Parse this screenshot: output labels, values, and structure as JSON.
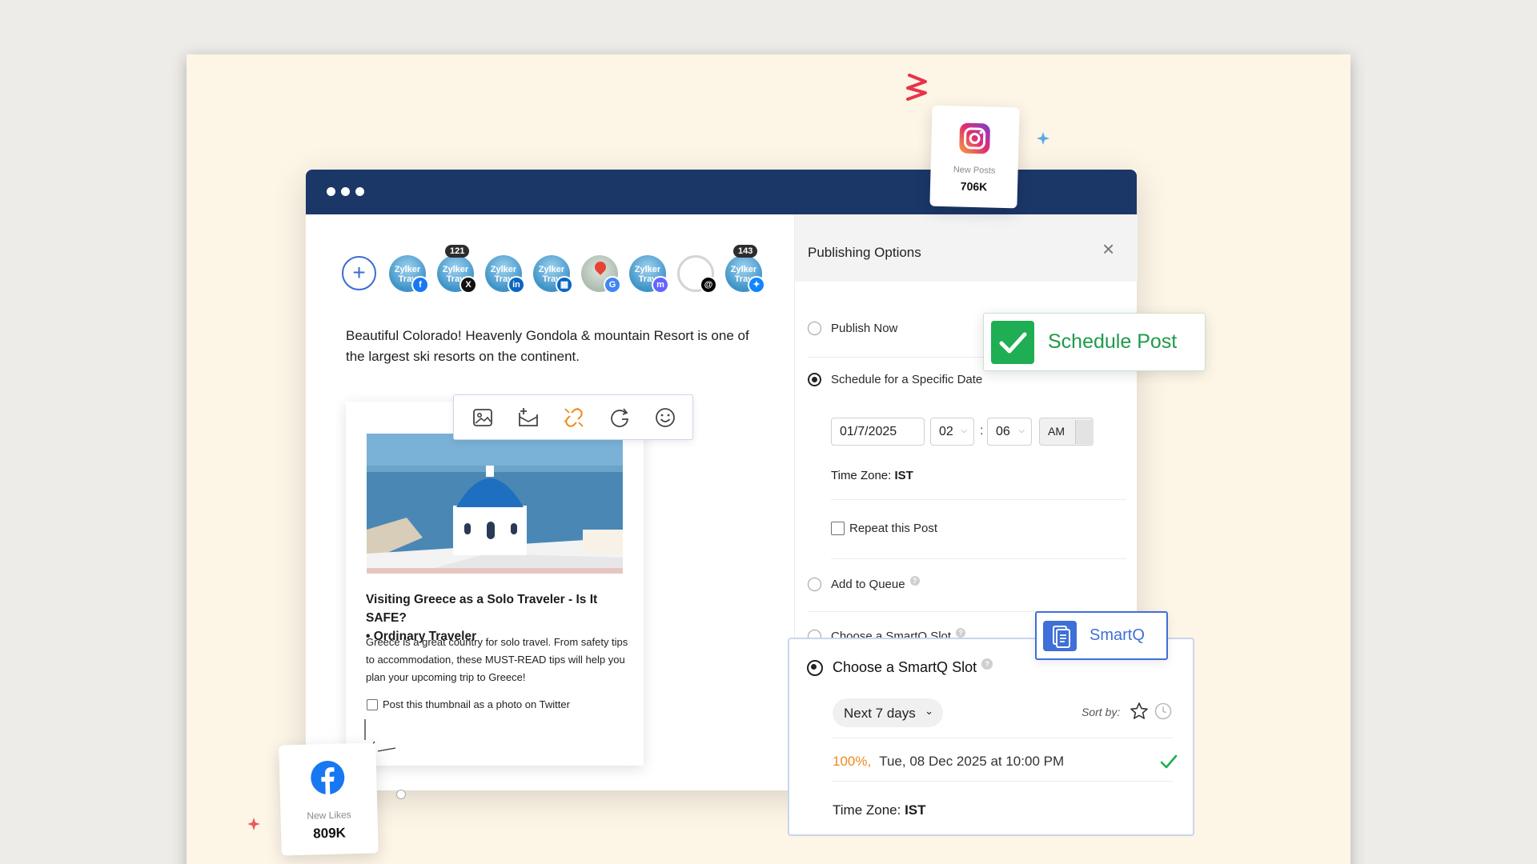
{
  "instagram_card": {
    "label": "New Posts",
    "value": "706K"
  },
  "facebook_card": {
    "label": "New Likes",
    "value": "809K"
  },
  "channels": {
    "avatars": [
      {
        "text": "Zylker Trav",
        "network": "facebook-icon",
        "count": ""
      },
      {
        "text": "Zylker Trav",
        "network": "x-icon",
        "count": "121"
      },
      {
        "text": "Zylker Trav",
        "network": "linkedin-icon",
        "count": ""
      },
      {
        "text": "Zylker Trav",
        "network": "linkedin-page-icon",
        "count": ""
      },
      {
        "text": "",
        "network": "google-business-icon",
        "count": ""
      },
      {
        "text": "Zylker Trav",
        "network": "mastodon-icon",
        "count": ""
      },
      {
        "text": "",
        "network": "threads-icon",
        "count": ""
      },
      {
        "text": "Zylker Trav",
        "network": "bluesky-icon",
        "count": "143"
      }
    ]
  },
  "composer": {
    "post_text": "Beautiful Colorado! Heavenly Gondola & mountain Resort is one of the largest ski resorts on the continent."
  },
  "preview": {
    "title_line1": "Visiting Greece as a Solo Traveler - Is It SAFE?",
    "title_line2": "• Ordinary Traveler",
    "description": "Greece is a great country for solo travel. From safety tips to accommodation, these MUST-READ tips will help you plan your upcoming trip to Greece!",
    "checkbox_label": "Post this thumbnail as a photo on Twitter"
  },
  "publishing": {
    "title": "Publishing Options",
    "publish_now": "Publish Now",
    "schedule_specific": "Schedule for a Specific Date",
    "date_value": "01/7/2025",
    "hour_value": "02",
    "minute_value": "06",
    "time_sep": ":",
    "ampm_value": "AM",
    "timezone_label": "Time Zone:",
    "timezone_value": "IST",
    "repeat_label": "Repeat this Post",
    "add_queue": "Add to Queue",
    "smartq_slot": "Choose a SmartQ Slot"
  },
  "schedule_badge": {
    "label": "Schedule Post"
  },
  "smartq": {
    "tag_label": "SmartQ",
    "heading": "Choose a SmartQ Slot",
    "range_value": "Next 7 days",
    "sort_label": "Sort by:",
    "slot_percent": "100%",
    "slot_sep": ",",
    "slot_datetime": "Tue, 08 Dec 2025 at 10:00 PM",
    "timezone_label": "Time Zone:",
    "timezone_value": "IST"
  },
  "colors": {
    "window_bar": "#1b3768",
    "accent_blue": "#3f6fd8",
    "success_green": "#1fae53",
    "percent_orange": "#f08a1c",
    "cream": "#fdf5e6"
  }
}
